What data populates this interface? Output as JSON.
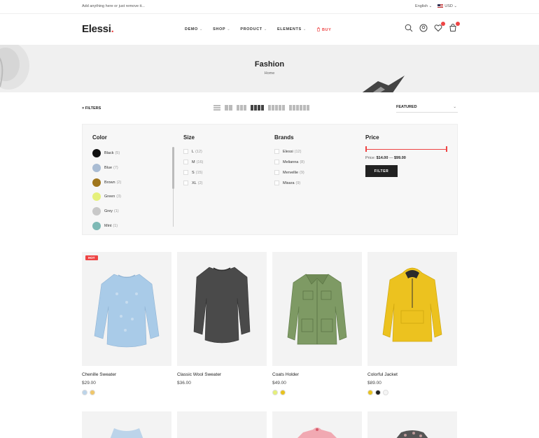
{
  "topbar": {
    "notice": "Add anything here or just remove it...",
    "language": "English",
    "currency": "USD",
    "caret": "⌄"
  },
  "header": {
    "logo": "Elessi",
    "logo_dot": ".",
    "nav": [
      {
        "label": "DEMO"
      },
      {
        "label": "SHOP"
      },
      {
        "label": "PRODUCT"
      },
      {
        "label": "ELEMENTS"
      },
      {
        "label": "BUY"
      }
    ],
    "icons": [
      "search-icon",
      "user-icon",
      "wishlist-heart-icon",
      "cart-icon"
    ]
  },
  "hero": {
    "title": "Fashion",
    "breadcrumb": "Home"
  },
  "toolbar": {
    "filters_label": "× FILTERS",
    "sort_value": "FEATURED",
    "sort_caret": "⌄",
    "grid_options": [
      1,
      2,
      3,
      4,
      5,
      6
    ],
    "grid_active": 4
  },
  "filters": {
    "color": {
      "heading": "Color",
      "items": [
        {
          "label": "Black",
          "count": "(5)",
          "hex": "#111111"
        },
        {
          "label": "Blue",
          "count": "(7)",
          "hex": "#a9bcd3"
        },
        {
          "label": "Brown",
          "count": "(2)",
          "hex": "#a0761c"
        },
        {
          "label": "Green",
          "count": "(3)",
          "hex": "#e5f07a"
        },
        {
          "label": "Grey",
          "count": "(1)",
          "hex": "#c8c8c8"
        },
        {
          "label": "Mint",
          "count": "(1)",
          "hex": "#7eb9b5"
        }
      ]
    },
    "size": {
      "heading": "Size",
      "items": [
        {
          "label": "L",
          "count": "(12)"
        },
        {
          "label": "M",
          "count": "(16)"
        },
        {
          "label": "S",
          "count": "(15)"
        },
        {
          "label": "XL",
          "count": "(2)"
        }
      ]
    },
    "brands": {
      "heading": "Brands",
      "items": [
        {
          "label": "Elessi",
          "count": "(12)"
        },
        {
          "label": "Melianna",
          "count": "(8)"
        },
        {
          "label": "Mervellie",
          "count": "(9)"
        },
        {
          "label": "Misara",
          "count": "(9)"
        }
      ]
    },
    "price": {
      "heading": "Price",
      "prefix": "Price:",
      "min": "$14.00",
      "separator": "—",
      "max": "$99.00",
      "button": "FILTER"
    }
  },
  "products": [
    {
      "name": "Chenille Sweater",
      "price": "$29.00",
      "badge": "HOT",
      "swatches": [
        "#bcd4ea",
        "#f0c76a"
      ]
    },
    {
      "name": "Classic Wool Sweater",
      "price": "$36.00",
      "badge": "",
      "swatches": []
    },
    {
      "name": "Coats Holder",
      "price": "$49.00",
      "badge": "",
      "swatches": [
        "#e5f07a",
        "#e8c21e"
      ]
    },
    {
      "name": "Colorful Jacket",
      "price": "$89.00",
      "badge": "",
      "swatches": [
        "#e8c21e",
        "#222222",
        "#f5f5f5"
      ]
    }
  ],
  "colors": {
    "accent": "#ee4444",
    "dark": "#222222"
  }
}
